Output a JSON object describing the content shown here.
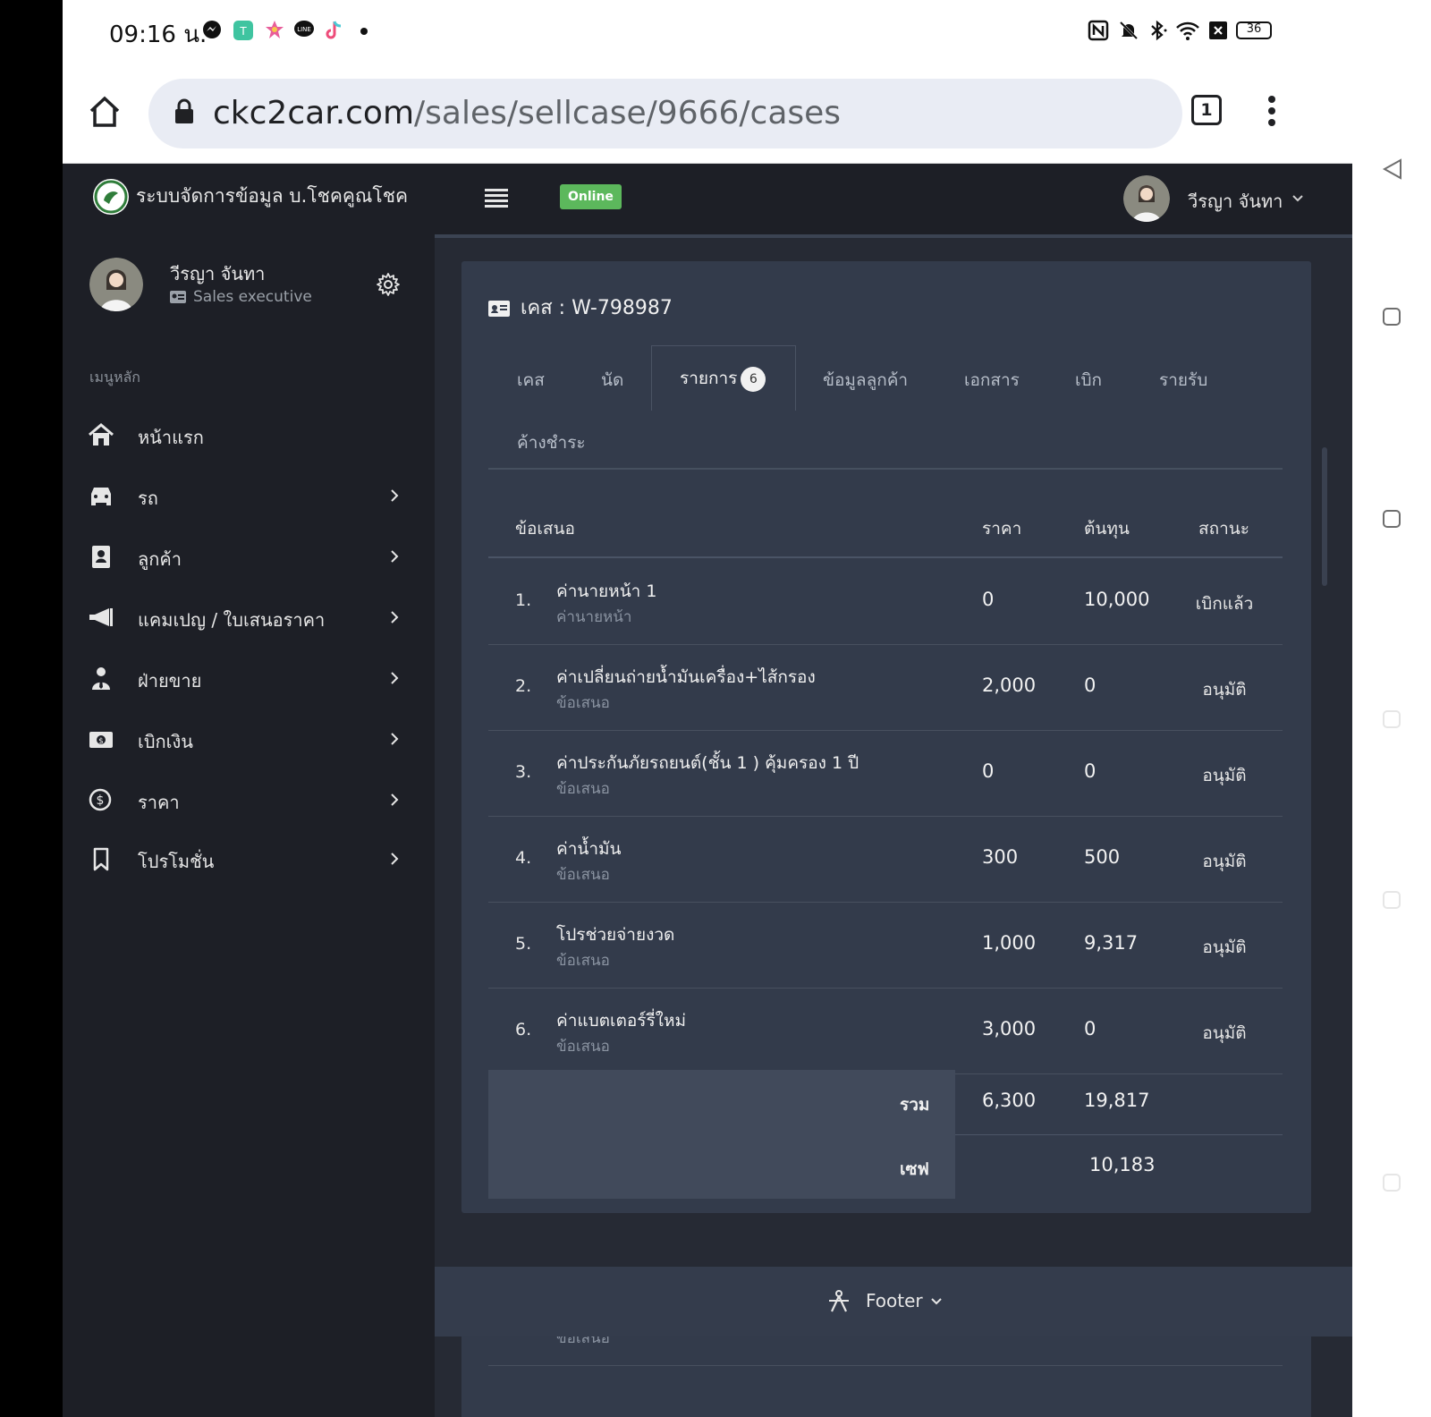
{
  "status_bar": {
    "time": "09:16 น.",
    "battery": "36"
  },
  "browser": {
    "url_host": "ckc2car.com",
    "url_path": "/sales/sellcase/9666/cases",
    "tab_count": "1"
  },
  "app": {
    "title": "ระบบจัดการข้อมูล บ.โชคคูณโชค",
    "online_label": "Online",
    "user_name": "วีรญา จันทา"
  },
  "sidebar": {
    "user_name": "วีรญา จันทา",
    "role": "Sales executive",
    "menu_header": "เมนูหลัก",
    "items": [
      {
        "label": "หน้าแรก",
        "icon": "home-icon",
        "has_sub": false
      },
      {
        "label": "รถ",
        "icon": "car-icon",
        "has_sub": true
      },
      {
        "label": "ลูกค้า",
        "icon": "contact-book-icon",
        "has_sub": true
      },
      {
        "label": "แคมเปญ / ใบเสนอราคา",
        "icon": "megaphone-icon",
        "has_sub": true
      },
      {
        "label": "ฝ่ายขาย",
        "icon": "user-tie-icon",
        "has_sub": true
      },
      {
        "label": "เบิกเงิน",
        "icon": "money-bill-icon",
        "has_sub": true
      },
      {
        "label": "ราคา",
        "icon": "dollar-circle-icon",
        "has_sub": true
      },
      {
        "label": "โปรโมชั่น",
        "icon": "bookmark-icon",
        "has_sub": true
      }
    ]
  },
  "case": {
    "title": "เคส : W-798987",
    "tabs": [
      {
        "label": "เคส"
      },
      {
        "label": "นัด"
      },
      {
        "label": "รายการ",
        "badge": "6",
        "active": true
      },
      {
        "label": "ข้อมูลลูกค้า"
      },
      {
        "label": "เอกสาร"
      },
      {
        "label": "เบิก"
      },
      {
        "label": "รายรับ"
      },
      {
        "label": "ค้างชำระ"
      }
    ],
    "table": {
      "headers": {
        "item": "ข้อเสนอ",
        "price": "ราคา",
        "cost": "ต้นทุน",
        "status": "สถานะ"
      },
      "rows": [
        {
          "num": "1.",
          "name": "ค่านายหน้า 1",
          "sub": "ค่านายหน้า",
          "price": "0",
          "cost": "10,000",
          "status": "เบิกแล้ว"
        },
        {
          "num": "2.",
          "name": "ค่าเปลี่ยนถ่ายน้ำมันเครื่อง+ไส้กรอง",
          "sub": "ข้อเสนอ",
          "price": "2,000",
          "cost": "0",
          "status": "อนุมัติ"
        },
        {
          "num": "3.",
          "name": "ค่าประกันภัยรถยนต์(ชั้น 1 ) คุ้มครอง 1 ปี",
          "sub": "ข้อเสนอ",
          "price": "0",
          "cost": "0",
          "status": "อนุมัติ"
        },
        {
          "num": "4.",
          "name": "ค่าน้ำมัน",
          "sub": "ข้อเสนอ",
          "price": "300",
          "cost": "500",
          "status": "อนุมัติ"
        },
        {
          "num": "5.",
          "name": "โปรช่วยจ่ายงวด",
          "sub": "ข้อเสนอ",
          "price": "1,000",
          "cost": "9,317",
          "status": "อนุมัติ"
        },
        {
          "num": "6.",
          "name": "ค่าแบตเตอร์รี่ใหม่",
          "sub": "ข้อเสนอ",
          "price": "3,000",
          "cost": "0",
          "status": "อนุมัติ"
        }
      ],
      "total_label": "รวม",
      "total_price": "6,300",
      "total_cost": "19,817",
      "profit_label": "เซฟ",
      "profit_value": "10,183"
    }
  },
  "footer": {
    "label": "Footer",
    "ghost_text": "ข้อเสนอ"
  },
  "colors": {
    "online": "#5cb85c",
    "card": "#333b4b",
    "sidebar": "#1d1f26",
    "content": "#262a34"
  }
}
